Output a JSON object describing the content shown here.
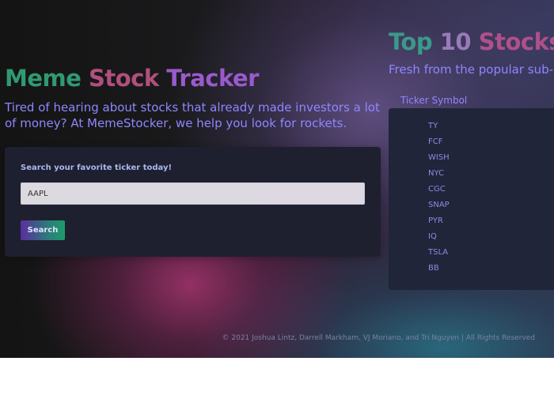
{
  "hero": {
    "title_part1": "Meme",
    "title_part2": "Stock",
    "title_part3": "Tracker",
    "subtitle": "Tired of hearing about stocks that already made investors a lot of money? At MemeStocker, we help you look for rockets."
  },
  "search": {
    "label": "Search your favorite ticker today!",
    "input_value": "AAPL",
    "button_label": "Search"
  },
  "top_stocks": {
    "title_part1": "Top",
    "title_part2": "10",
    "title_part3": "Stocks",
    "subtitle": "Fresh from the popular sub-",
    "column_header": "Ticker Symbol",
    "tickers": [
      "TY",
      "FCF",
      "WISH",
      "NYC",
      "CGC",
      "SNAP",
      "PYR",
      "IQ",
      "TSLA",
      "BB"
    ]
  },
  "footer": {
    "text": "© 2021 Joshua Lintz, Darrell Markham, VJ Moriano, and Tri Nguyen | All Rights Reserved"
  },
  "colors": {
    "accent_text": "#8f86ff",
    "meme_green": "#2f9a72",
    "stock_pink": "#b0507e",
    "tracker_purple": "#9a5acb",
    "card_bg": "#1e2030"
  }
}
